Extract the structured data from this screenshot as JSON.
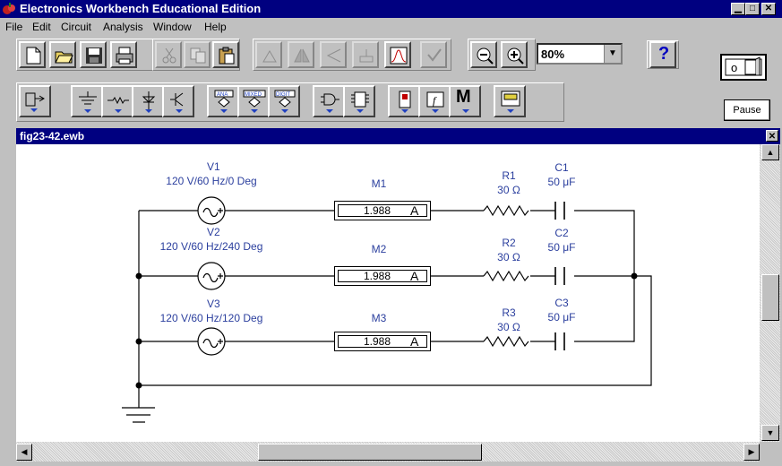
{
  "window": {
    "title": "Electronics Workbench Educational Edition"
  },
  "menu": {
    "items": [
      "File",
      "Edit",
      "Circuit",
      "Analysis",
      "Window",
      "Help"
    ]
  },
  "toolbar": {
    "zoom_value": "80%",
    "help_label": "?",
    "pause_label": "Pause",
    "meter_parts_label": "M"
  },
  "document": {
    "title": "fig23-42.ewb"
  },
  "circuit": {
    "sources": [
      {
        "name": "V1",
        "spec": "120 V/60 Hz/0 Deg"
      },
      {
        "name": "V2",
        "spec": "120 V/60 Hz/240 Deg"
      },
      {
        "name": "V3",
        "spec": "120 V/60 Hz/120 Deg"
      }
    ],
    "ammeters": [
      {
        "name": "M1",
        "reading": "1.988",
        "unit": "A"
      },
      {
        "name": "M2",
        "reading": "1.988",
        "unit": "A"
      },
      {
        "name": "M3",
        "reading": "1.988",
        "unit": "A"
      }
    ],
    "resistors": [
      {
        "name": "R1",
        "value": "30 Ω"
      },
      {
        "name": "R2",
        "value": "30 Ω"
      },
      {
        "name": "R3",
        "value": "30 Ω"
      }
    ],
    "capacitors": [
      {
        "name": "C1",
        "value": "50 μF"
      },
      {
        "name": "C2",
        "value": "50 μF"
      },
      {
        "name": "C3",
        "value": "50 μF"
      }
    ]
  },
  "colors": {
    "title_bar": "#000080",
    "component_label": "#2b3f9e",
    "face": "#c0c0c0"
  }
}
